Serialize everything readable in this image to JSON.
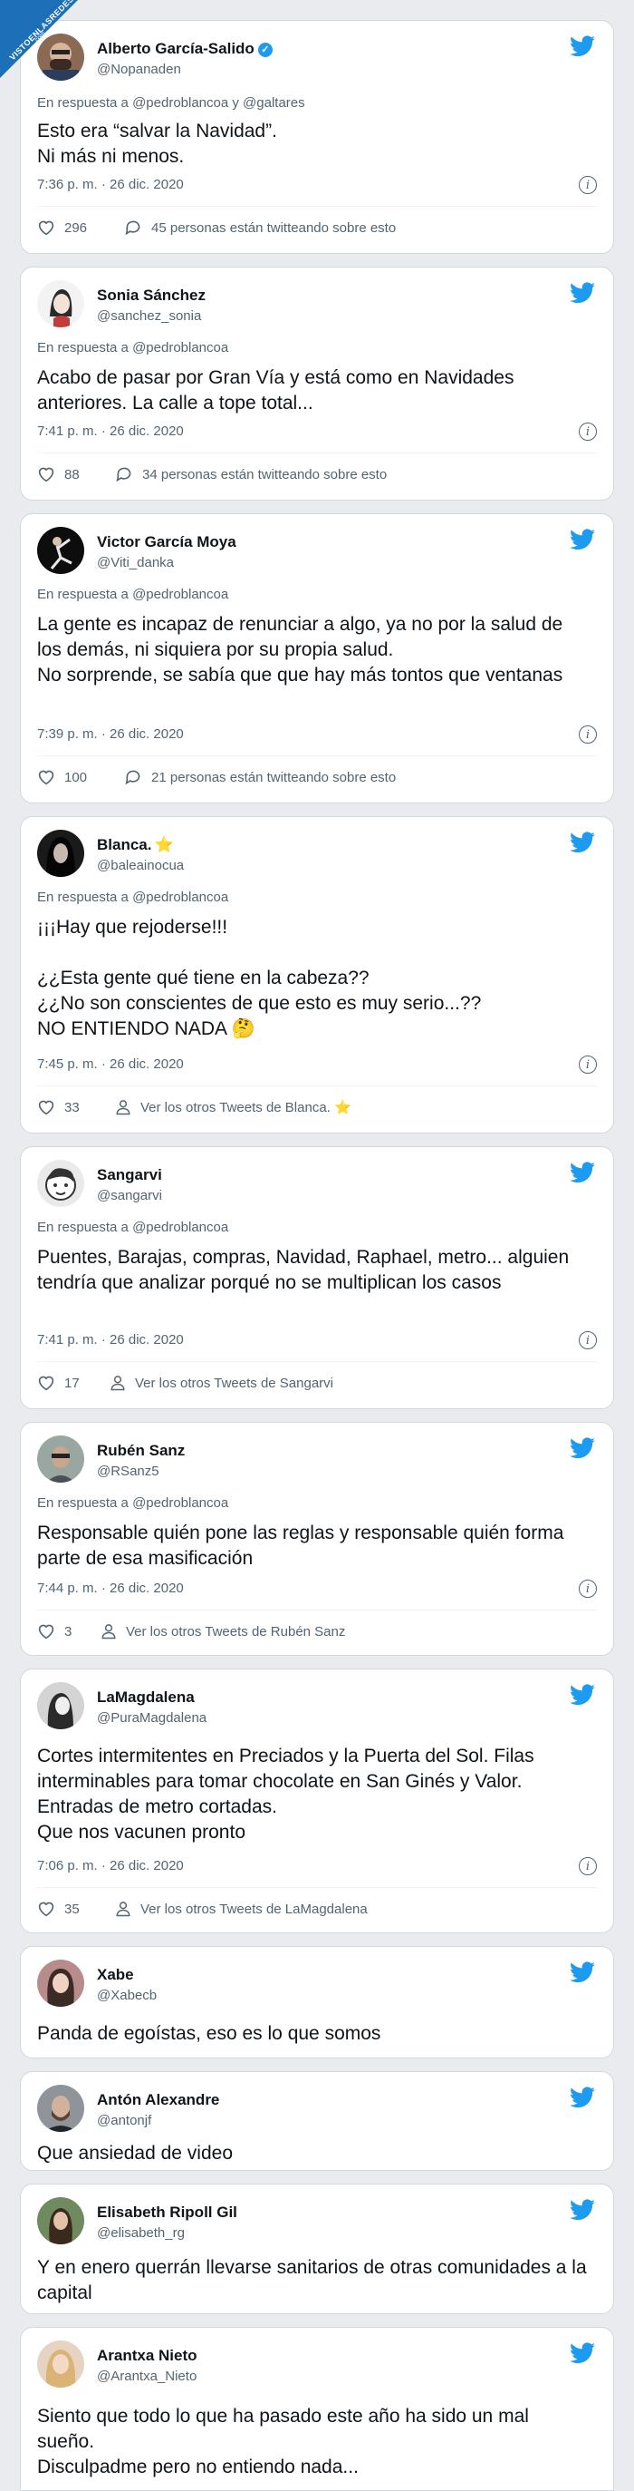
{
  "watermark": {
    "text": "VISTOENLASREDES",
    "sub": ".com",
    "color": "#1d6fb8"
  },
  "accent": "#1d9bf0",
  "tweets": [
    {
      "name": "Alberto García-Salido",
      "verified": true,
      "handle": "@Nopanaden",
      "reply": "En respuesta a @pedroblancoa y @galtares",
      "text": "Esto era “salvar la Navidad”.\nNi más ni menos.",
      "time": "7:36 p. m. · 26 dic. 2020",
      "likes": "296",
      "action": "45 personas están twitteando sobre esto",
      "action_icon": "comment-icon",
      "avatar": "avatar-bearded-man"
    },
    {
      "name": "Sonia Sánchez",
      "handle": "@sanchez_sonia",
      "reply": "En respuesta a @pedroblancoa",
      "text": "Acabo de pasar por Gran Vía y está como en Navidades anteriores. La calle a tope total...",
      "time": "7:41 p. m. · 26 dic. 2020",
      "likes": "88",
      "action": "34 personas están twitteando sobre esto",
      "action_icon": "comment-icon",
      "avatar": "avatar-woman-sketch"
    },
    {
      "name": "Victor García Moya",
      "handle": "@Viti_danka",
      "reply": "En respuesta a @pedroblancoa",
      "text": "La gente es incapaz de renunciar a algo, ya no por la salud de los demás, ni siquiera por su propia salud.\nNo sorprende, se sabía que que hay más tontos que ventanas",
      "time": "7:39 p. m. · 26 dic. 2020",
      "likes": "100",
      "action": "21 personas están twitteando sobre esto",
      "action_icon": "comment-icon",
      "avatar": "avatar-dancer"
    },
    {
      "name": "Blanca.",
      "star": "⭐",
      "handle": "@baleainocua",
      "reply": "En respuesta a @pedroblancoa",
      "text": "¡¡¡Hay que rejoderse!!!\n\n¿¿Esta gente qué tiene en la cabeza??\n¿¿No son conscientes de que esto es muy serio...??\nNO ENTIENDO NADA 🤔",
      "time": "7:45 p. m. · 26 dic. 2020",
      "likes": "33",
      "action": "Ver los otros Tweets de Blanca. ⭐",
      "action_icon": "person-icon",
      "avatar": "avatar-dark-hair"
    },
    {
      "name": "Sangarvi",
      "handle": "@sangarvi",
      "reply": "En respuesta a @pedroblancoa",
      "text": "Puentes, Barajas, compras, Navidad, Raphael, metro... alguien tendría que analizar porqué no se multiplican los casos",
      "time": "7:41 p. m. · 26 dic. 2020",
      "likes": "17",
      "action": "Ver los otros Tweets de Sangarvi",
      "action_icon": "person-icon",
      "avatar": "avatar-cartoon-face"
    },
    {
      "name": "Rubén Sanz",
      "handle": "@RSanz5",
      "reply": "En respuesta a @pedroblancoa",
      "text": "Responsable quién pone las reglas y responsable quién forma parte de esa masificación",
      "time": "7:44 p. m. · 26 dic. 2020",
      "likes": "3",
      "action": "Ver los otros Tweets de Rubén Sanz",
      "action_icon": "person-icon",
      "avatar": "avatar-man-photo"
    },
    {
      "name": "LaMagdalena",
      "handle": "@PuraMagdalena",
      "text": "Cortes intermitentes en Preciados y la Puerta del Sol. Filas interminables para tomar chocolate en San Ginés y Valor.\nEntradas de metro cortadas.\nQue nos vacunen pronto",
      "time": "7:06 p. m. · 26 dic. 2020",
      "likes": "35",
      "action": "Ver los otros Tweets de LaMagdalena",
      "action_icon": "person-icon",
      "avatar": "avatar-vintage-portrait"
    },
    {
      "name": "Xabe",
      "handle": "@Xabecb",
      "text": "Panda de egoístas, eso es lo que somos",
      "avatar": "avatar-woman-photo"
    },
    {
      "name": "Antón Alexandre",
      "handle": "@antonjf",
      "text": "Que ansiedad de video",
      "avatar": "avatar-man-beard"
    },
    {
      "name": "Elisabeth Ripoll Gil",
      "handle": "@elisabeth_rg",
      "text": "Y en enero querrán llevarse sanitarios de otras comunidades a la capital",
      "avatar": "avatar-woman-outdoor"
    },
    {
      "name": "Arantxa Nieto",
      "handle": "@Arantxa_Nieto",
      "text": "Siento que todo lo que ha pasado este año ha sido un mal sueño.\nDisculpadme pero no entiendo nada...",
      "avatar": "avatar-blonde-woman"
    }
  ]
}
